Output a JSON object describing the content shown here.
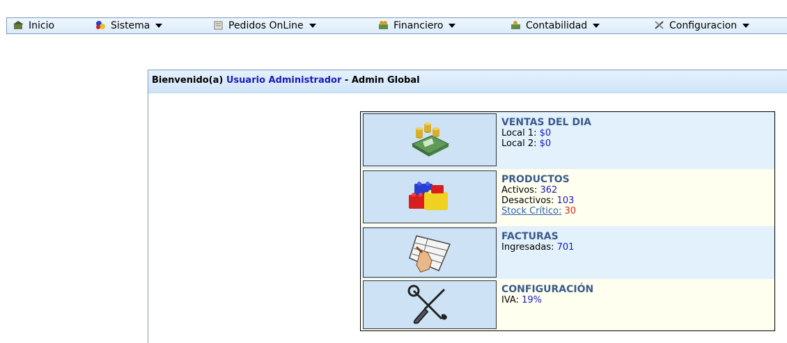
{
  "menu": [
    {
      "label": "Inicio",
      "icon": "home-icon",
      "caret": false
    },
    {
      "label": "Sistema",
      "icon": "system-icon",
      "caret": true
    },
    {
      "label": "Pedidos OnLine",
      "icon": "orders-icon",
      "caret": true
    },
    {
      "label": "Financiero",
      "icon": "money-icon",
      "caret": true
    },
    {
      "label": "Contabilidad",
      "icon": "accounting-icon",
      "caret": true
    },
    {
      "label": "Configuracion",
      "icon": "tools-icon",
      "caret": true
    }
  ],
  "welcome": {
    "prefix": "Bienvenido(a)",
    "user": "Usuario Administrador",
    "suffix": "- Admin Global"
  },
  "ventas": {
    "title": "VENTAS DEL DIA",
    "l1_label": "Local 1:",
    "l1_value": "$0",
    "l2_label": "Local 2:",
    "l2_value": "$0"
  },
  "productos": {
    "title": "PRODUCTOS",
    "activos_label": "Activos:",
    "activos_value": "362",
    "desactivos_label": "Desactivos:",
    "desactivos_value": "103",
    "stock_label": "Stock Crítico:",
    "stock_value": "30"
  },
  "facturas": {
    "title": "FACTURAS",
    "ing_label": "Ingresadas:",
    "ing_value": "701"
  },
  "config": {
    "title": "CONFIGURACIÓN",
    "iva_label": "IVA:",
    "iva_value": "19%"
  }
}
